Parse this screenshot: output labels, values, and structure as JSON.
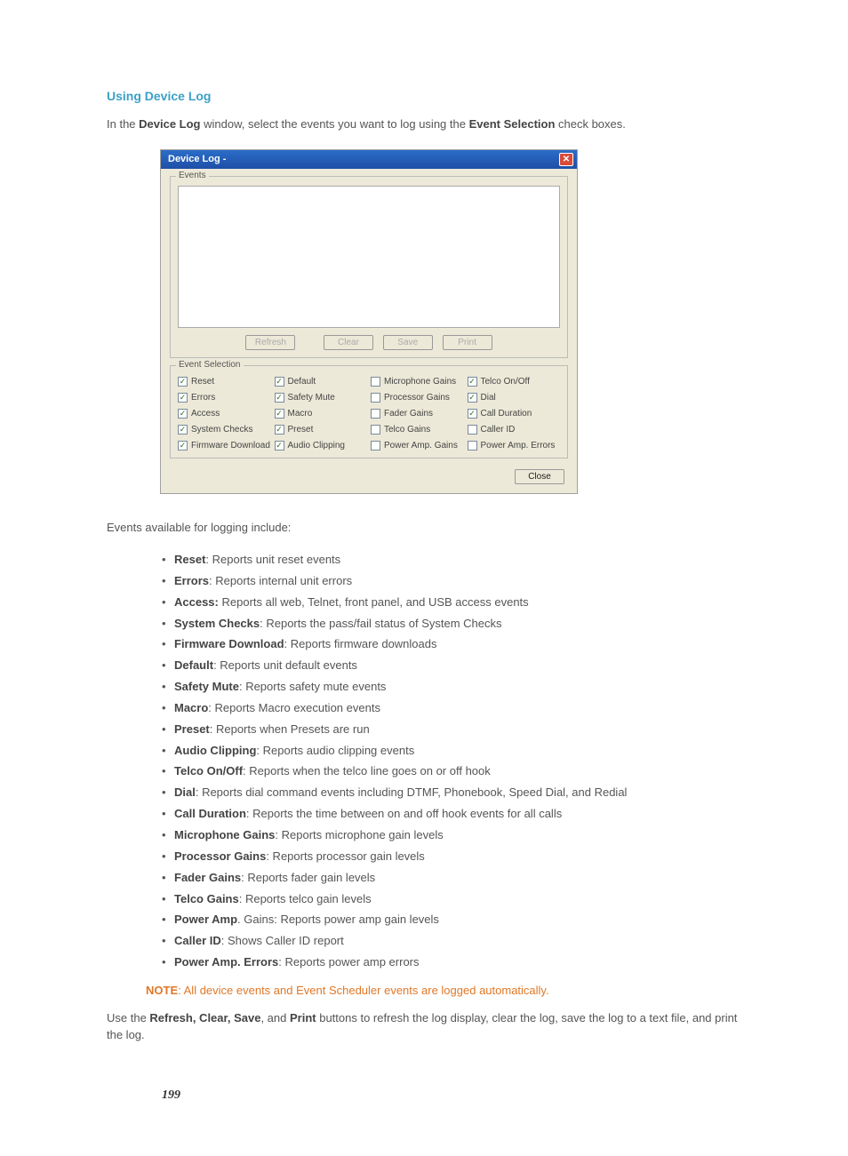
{
  "section_title": "Using Device Log",
  "intro": {
    "pre": "In the ",
    "b1": "Device Log",
    "mid": " window, select the events you want to log using the ",
    "b2": "Event Selection",
    "post": " check boxes."
  },
  "dialog": {
    "title": "Device Log -",
    "close_glyph": "✕",
    "events_label": "Events",
    "buttons": {
      "refresh": "Refresh",
      "clear": "Clear",
      "save": "Save",
      "print": "Print"
    },
    "event_selection_label": "Event Selection",
    "checkboxes": [
      {
        "label": "Reset",
        "checked": true
      },
      {
        "label": "Default",
        "checked": true
      },
      {
        "label": "Microphone Gains",
        "checked": false
      },
      {
        "label": "Telco On/Off",
        "checked": true
      },
      {
        "label": "Errors",
        "checked": true
      },
      {
        "label": "Safety Mute",
        "checked": true
      },
      {
        "label": "Processor Gains",
        "checked": false
      },
      {
        "label": "Dial",
        "checked": true
      },
      {
        "label": "Access",
        "checked": true
      },
      {
        "label": "Macro",
        "checked": true
      },
      {
        "label": "Fader Gains",
        "checked": false
      },
      {
        "label": "Call Duration",
        "checked": true
      },
      {
        "label": "System Checks",
        "checked": true
      },
      {
        "label": "Preset",
        "checked": true
      },
      {
        "label": "Telco Gains",
        "checked": false
      },
      {
        "label": "Caller ID",
        "checked": false
      },
      {
        "label": "Firmware Download",
        "checked": true
      },
      {
        "label": "Audio Clipping",
        "checked": true
      },
      {
        "label": "Power Amp. Gains",
        "checked": false
      },
      {
        "label": "Power Amp. Errors",
        "checked": false
      }
    ],
    "close_label": "Close"
  },
  "events_intro": "Events available for logging include:",
  "events": [
    {
      "name": "Reset",
      "sep": ": ",
      "desc": "Reports unit reset events"
    },
    {
      "name": "Errors",
      "sep": ": ",
      "desc": "Reports internal unit errors"
    },
    {
      "name": "Access:",
      "sep": " ",
      "desc": "Reports all web, Telnet, front panel, and USB access events"
    },
    {
      "name": "System Checks",
      "sep": ": ",
      "desc": "Reports the pass/fail status of System Checks"
    },
    {
      "name": "Firmware Download",
      "sep": ": ",
      "desc": "Reports firmware downloads"
    },
    {
      "name": "Default",
      "sep": ": ",
      "desc": "Reports unit default events"
    },
    {
      "name": "Safety Mute",
      "sep": ": ",
      "desc": "Reports safety mute events"
    },
    {
      "name": "Macro",
      "sep": ": ",
      "desc": "Reports Macro execution events"
    },
    {
      "name": "Preset",
      "sep": ": ",
      "desc": "Reports when Presets are run"
    },
    {
      "name": "Audio Clipping",
      "sep": ": ",
      "desc": "Reports audio clipping events"
    },
    {
      "name": "Telco On/Off",
      "sep": ": ",
      "desc": "Reports when the telco line goes on or off hook"
    },
    {
      "name": "Dial",
      "sep": ": ",
      "desc": "Reports dial command events including DTMF, Phonebook, Speed Dial, and Redial"
    },
    {
      "name": "Call Duration",
      "sep": ": ",
      "desc": "Reports the time between on and off hook events for all calls"
    },
    {
      "name": "Microphone Gains",
      "sep": ": ",
      "desc": "Reports microphone gain levels"
    },
    {
      "name": "Processor Gains",
      "sep": ": ",
      "desc": "Reports processor gain levels"
    },
    {
      "name": "Fader Gains",
      "sep": ": ",
      "desc": "Reports fader gain levels"
    },
    {
      "name": "Telco Gains",
      "sep": ": ",
      "desc": "Reports telco gain levels"
    },
    {
      "name": "Power Amp",
      "sep": ". ",
      "desc": "Gains: Reports power amp gain levels"
    },
    {
      "name": "Caller ID",
      "sep": ": ",
      "desc": "Shows Caller ID report"
    },
    {
      "name": "Power Amp. Errors",
      "sep": ": ",
      "desc": "Reports power amp errors"
    }
  ],
  "note": {
    "label": "NOTE",
    "text": ": All device events and Event Scheduler events are logged automatically."
  },
  "closing": {
    "pre": "Use the ",
    "b1": "Refresh, Clear, Save",
    "mid": ", and ",
    "b2": "Print",
    "post": " buttons to refresh the log display, clear the log, save the log to a text file, and print the log."
  },
  "page_number": "199"
}
